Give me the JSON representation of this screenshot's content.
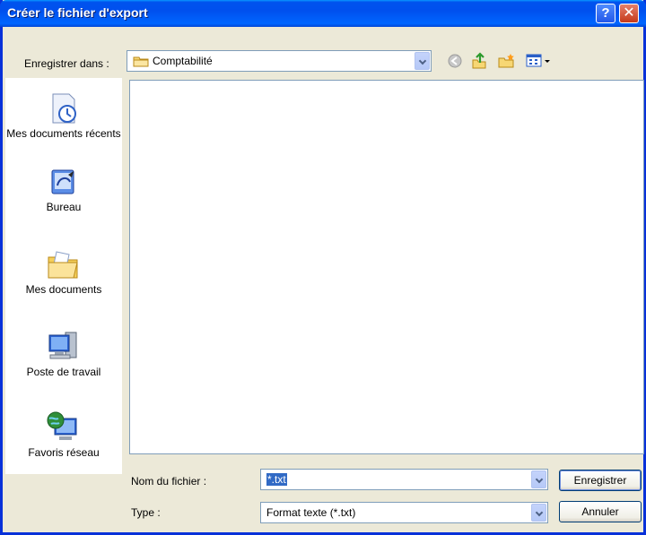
{
  "window": {
    "title": "Créer le fichier d'export"
  },
  "lookin": {
    "label": "Enregistrer dans :",
    "value": "Comptabilité"
  },
  "places": [
    {
      "label": "Mes documents récents",
      "icon": "recent-documents-icon"
    },
    {
      "label": "Bureau",
      "icon": "desktop-icon"
    },
    {
      "label": "Mes documents",
      "icon": "my-documents-icon"
    },
    {
      "label": "Poste de travail",
      "icon": "my-computer-icon"
    },
    {
      "label": "Favoris réseau",
      "icon": "network-places-icon"
    }
  ],
  "filename": {
    "label": "Nom du fichier :",
    "value": "*.txt"
  },
  "filetype": {
    "label": "Type :",
    "value": "Format texte (*.txt)"
  },
  "buttons": {
    "save": "Enregistrer",
    "cancel": "Annuler"
  }
}
